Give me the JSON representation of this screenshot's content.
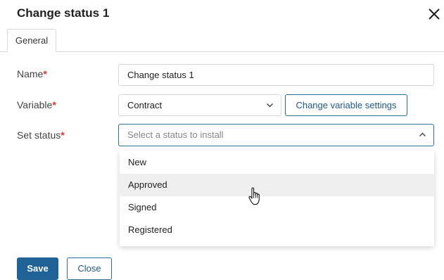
{
  "dialog": {
    "title": "Change status 1"
  },
  "tabs": [
    {
      "label": "General",
      "active": true
    }
  ],
  "form": {
    "name": {
      "label": "Name",
      "required_mark": "*",
      "value": "Change status 1"
    },
    "variable": {
      "label": "Variable",
      "required_mark": "*",
      "value": "Contract",
      "settings_button": "Change variable settings"
    },
    "set_status": {
      "label": "Set status",
      "required_mark": "*",
      "placeholder": "Select a status to install",
      "expanded": true
    }
  },
  "status_options": [
    {
      "label": "New",
      "hovered": false
    },
    {
      "label": "Approved",
      "hovered": true
    },
    {
      "label": "Signed",
      "hovered": false
    },
    {
      "label": "Registered",
      "hovered": false
    }
  ],
  "footer": {
    "save_label": "Save",
    "close_label": "Close"
  },
  "colors": {
    "primary": "#1f6396",
    "required": "#dd3333",
    "focus_border": "#2f6f9f",
    "hover_bg": "#efefef"
  }
}
